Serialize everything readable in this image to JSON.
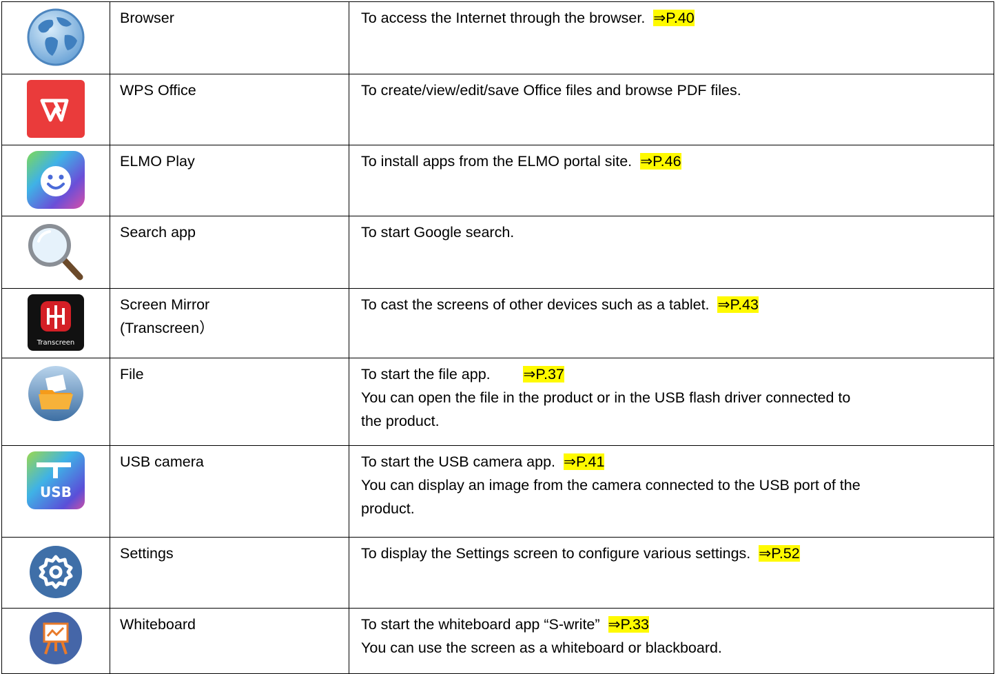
{
  "rows": [
    {
      "icon": "globe-icon",
      "name": [
        "Browser"
      ],
      "desc": [
        {
          "text": "To access the Internet through the browser.  ",
          "ref": "⇒P.40"
        }
      ]
    },
    {
      "icon": "wps-office-icon",
      "name": [
        "WPS Office"
      ],
      "desc": [
        {
          "text": "To create/view/edit/save Office files and browse PDF files."
        }
      ]
    },
    {
      "icon": "smiley-icon",
      "name": [
        "ELMO Play"
      ],
      "desc": [
        {
          "text": "To install apps from the ELMO portal site.  ",
          "ref": "⇒P.46"
        }
      ]
    },
    {
      "icon": "magnifier-icon",
      "name": [
        "Search app"
      ],
      "desc": [
        {
          "text": "To start Google search."
        }
      ]
    },
    {
      "icon": "transcreen-icon",
      "name": [
        "Screen Mirror",
        "(Transcreen）"
      ],
      "desc": [
        {
          "text": "To cast the screens of other devices such as a tablet.  ",
          "ref": "⇒P.43"
        }
      ]
    },
    {
      "icon": "folder-icon",
      "name": [
        "File"
      ],
      "desc": [
        {
          "text": "To start the file app.        ",
          "ref": "⇒P.37"
        },
        {
          "text": "You can open the file in the product or in the USB flash driver connected to"
        },
        {
          "text": "the product."
        }
      ]
    },
    {
      "icon": "usb-camera-icon",
      "name": [
        "USB camera"
      ],
      "desc": [
        {
          "text": "To start the USB camera app.  ",
          "ref": "⇒P.41"
        },
        {
          "text": "You can display an image from the camera connected to the USB port of the"
        },
        {
          "text": "product."
        }
      ]
    },
    {
      "icon": "gear-icon",
      "name": [
        "Settings"
      ],
      "desc": [
        {
          "text": "To display the Settings screen to configure various settings.  ",
          "ref": "⇒P.52"
        }
      ]
    },
    {
      "icon": "whiteboard-icon",
      "name": [
        "Whiteboard"
      ],
      "desc": [
        {
          "text": "To start the whiteboard app “S-write”  ",
          "ref": "⇒P.33"
        },
        {
          "text": "You can use the screen as a whiteboard or blackboard."
        }
      ]
    }
  ],
  "icon_text": {
    "transcreen": "Transcreen",
    "usb": "USB"
  }
}
